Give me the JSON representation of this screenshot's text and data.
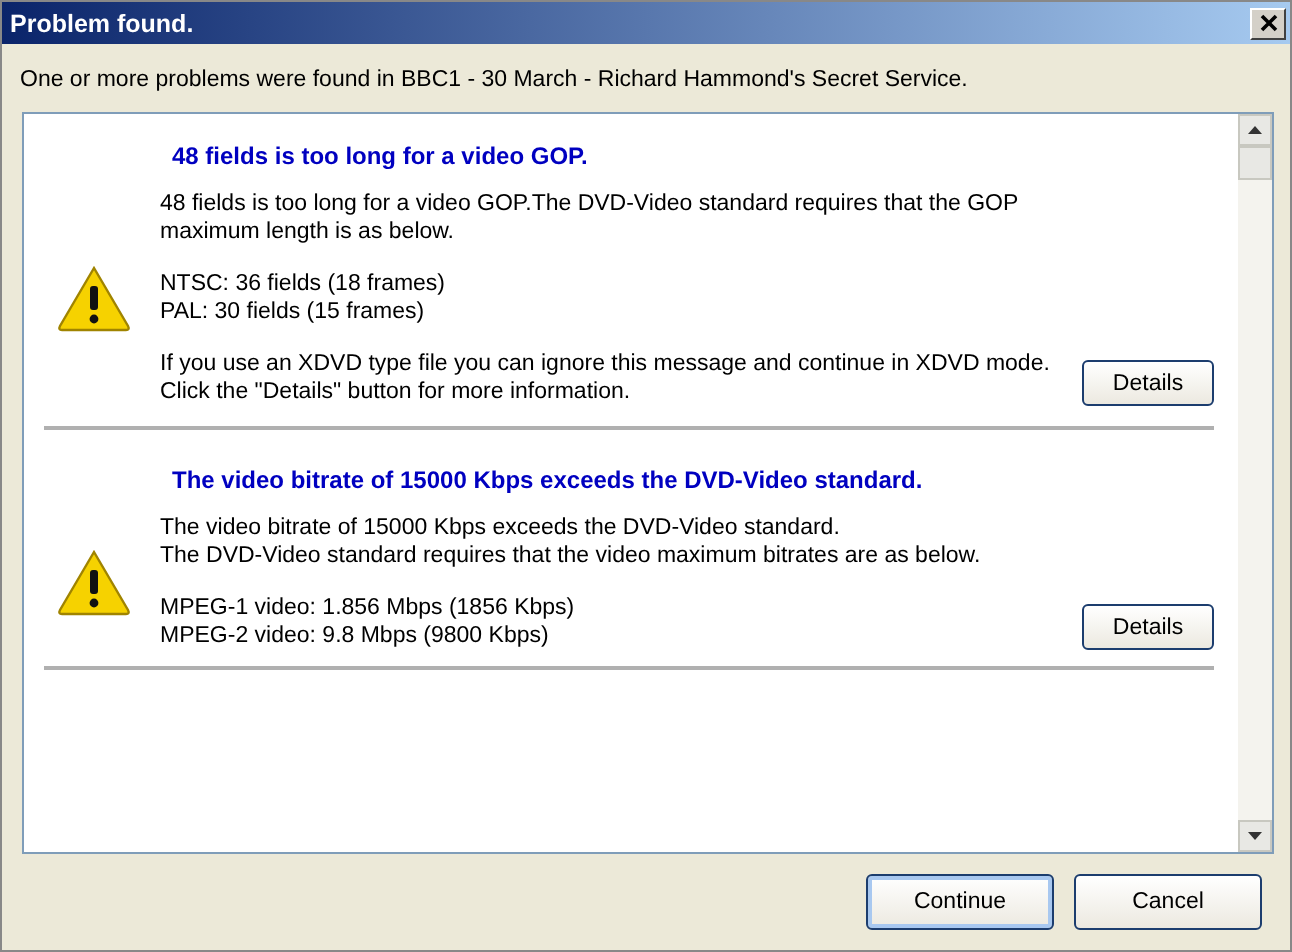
{
  "window": {
    "title": "Problem found."
  },
  "summary": "One or more problems were found in BBC1 - 30 March - Richard Hammond's Secret Service.",
  "problems": [
    {
      "title": "48 fields is too long for a video GOP.",
      "paragraphs": [
        [
          "48 fields is too long for a video GOP.The DVD-Video standard requires that the GOP maximum length is as below."
        ],
        [
          "NTSC: 36 fields (18 frames)",
          "PAL: 30 fields (15 frames)"
        ],
        [
          "If you use an XDVD type file you can ignore this message and continue in XDVD mode. Click the \"Details\" button for more information."
        ]
      ],
      "button": "Details"
    },
    {
      "title": "The video bitrate of 15000 Kbps exceeds the DVD-Video standard.",
      "paragraphs": [
        [
          "The video bitrate of 15000 Kbps exceeds the DVD-Video standard.",
          "The DVD-Video standard requires that the video maximum bitrates are as below."
        ],
        [
          "MPEG-1 video: 1.856 Mbps (1856 Kbps)",
          "MPEG-2 video: 9.8 Mbps (9800 Kbps)"
        ]
      ],
      "button": "Details"
    }
  ],
  "buttons": [
    {
      "label": "Continue",
      "default": true
    },
    {
      "label": "Cancel",
      "default": false
    }
  ]
}
